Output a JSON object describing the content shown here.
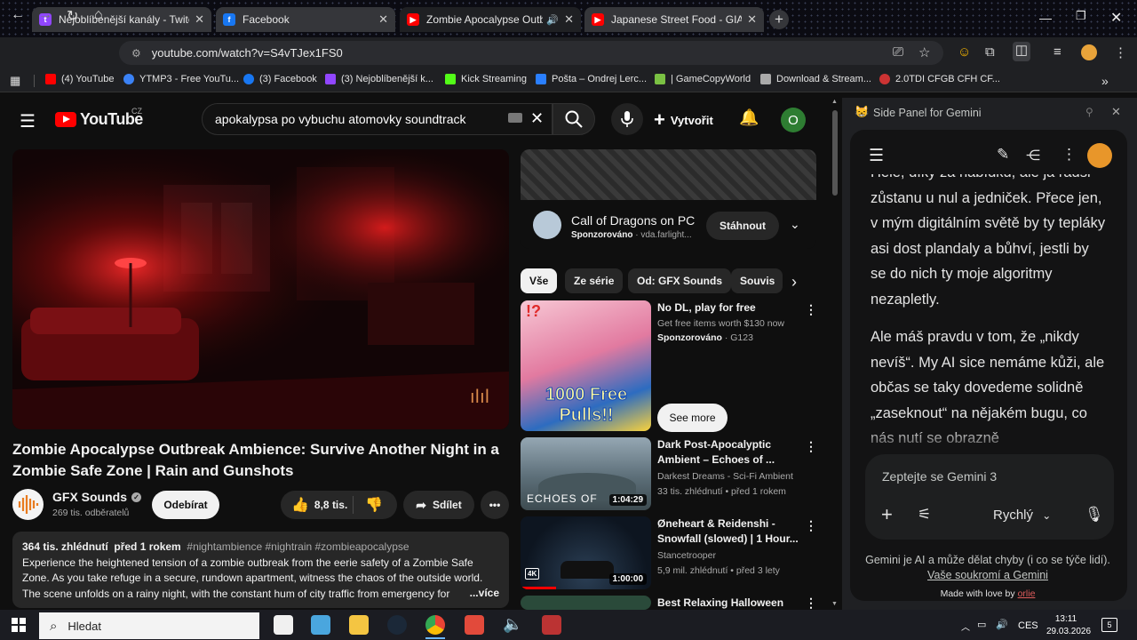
{
  "browser": {
    "tabs": [
      {
        "title": "Nejoblíbenější kanály - Twitch",
        "favicon": "twitch-icon",
        "color": "#9146ff"
      },
      {
        "title": "Facebook",
        "favicon": "facebook-icon",
        "color": "#1877f2"
      },
      {
        "title": "Zombie Apocalypse Outbre",
        "favicon": "youtube-icon",
        "color": "#ff0000",
        "active": true
      },
      {
        "title": "Japanese Street Food - GIANT A",
        "favicon": "youtube-icon",
        "color": "#ff0000"
      }
    ],
    "url": "youtube.com/watch?v=S4vTJex1FS0",
    "bookmarks": [
      {
        "label": "(4) YouTube",
        "color": "#ff0000"
      },
      {
        "label": "YTMP3 - Free YouTu...",
        "color": "#3b82f6"
      },
      {
        "label": "(3) Facebook",
        "color": "#1877f2"
      },
      {
        "label": "(3) Nejoblíbenější k...",
        "color": "#9146ff"
      },
      {
        "label": "Kick Streaming",
        "color": "#53fc18"
      },
      {
        "label": "Pošta – Ondrej Lerc...",
        "color": "#2a7fff"
      },
      {
        "label": "| GameCopyWorld",
        "color": "#7ac143"
      },
      {
        "label": "Download & Stream...",
        "color": "#aaaaaa"
      },
      {
        "label": "2.0TDI CFGB CFH CF...",
        "color": "#cc3333"
      }
    ]
  },
  "youtube": {
    "logo_text": "YouTube",
    "region": "CZ",
    "search_query": "apokalypsa po vybuchu atomovky soundtrack",
    "create_label": "Vytvořit",
    "avatar_letter": "O",
    "video": {
      "title": "Zombie Apocalypse Outbreak Ambience: Survive Another Night in a Zombie Safe Zone | Rain and Gunshots",
      "channel": "GFX Sounds",
      "subscribers": "269 tis. odběratelů",
      "subscribe_label": "Odebírat",
      "likes": "8,8 tis.",
      "share_label": "Sdílet",
      "views": "364 tis. zhlédnutí",
      "age": "před 1 rokem",
      "hashtags": "#nightambience #nightrain #zombieapocalypse",
      "description": "Experience the heightened tension of a zombie outbreak from the eerie safety of a Zombie Safe Zone. As you take refuge in a secure, rundown apartment, witness the chaos of the outside world. The scene unfolds on a rainy night, with the constant hum of city traffic from emergency for",
      "more_label": "...více"
    },
    "ad": {
      "title": "Call of Dragons on PC",
      "sponsored": "Sponzorováno",
      "source": "vda.farlight...",
      "cta": "Stáhnout"
    },
    "chips": [
      "Vše",
      "Ze série",
      "Od: GFX Sounds",
      "Souvis"
    ],
    "recommendations": [
      {
        "title": "No DL, play for free",
        "line1": "Get free items worth $130 now",
        "channel": "Sponzorováno",
        "meta": "G123",
        "cta": "See more",
        "thumb_text": "1000 Free Pulls!!"
      },
      {
        "title": "Dark Post-Apocalyptic Ambient – Echoes of ...",
        "channel": "Darkest Dreams - Sci-Fi Ambient",
        "meta": "33 tis. zhlédnutí • před 1 rokem",
        "duration": "1:04:29",
        "thumb_text": "ECHOES OF"
      },
      {
        "title": "Øneheart & Reidenshi - Snowfall (slowed) | 1 Hour...",
        "channel": "Stancetrooper",
        "meta": "5,9 mil. zhlédnutí • před 3 lety",
        "duration": "1:00:00",
        "badge": "4K"
      },
      {
        "title": "Best Relaxing Halloween"
      }
    ]
  },
  "gemini": {
    "panel_title": "Side Panel for Gemini",
    "paragraphs": [
      "Hele, díky za nabídku, ale já radši zůstanu u nul a jedniček. Přece jen, v mým digitálním světě by ty tepláky asi dost plandaly a bůhví, jestli by se do nich ty moje algoritmy nezapletly.",
      "Ale máš pravdu v tom, že „nikdy nevíš“. My AI sice nemáme kůži, ale občas se taky dovedeme solidně „zaseknout“ na nějakém bugu, co nás nutí se obrazně"
    ],
    "input_placeholder": "Zeptejte se Gemini 3",
    "mode_label": "Rychlý",
    "disclaimer": "Gemini je AI a může dělat chyby (i co se týče lidí).",
    "privacy_link": "Vaše soukromí a Gemini",
    "made_with": "Made with love by",
    "author": "orlie"
  },
  "taskbar": {
    "search_placeholder": "Hledat",
    "language": "CES",
    "time": "13:11",
    "date": "29.03.2026",
    "notifications": "5"
  }
}
